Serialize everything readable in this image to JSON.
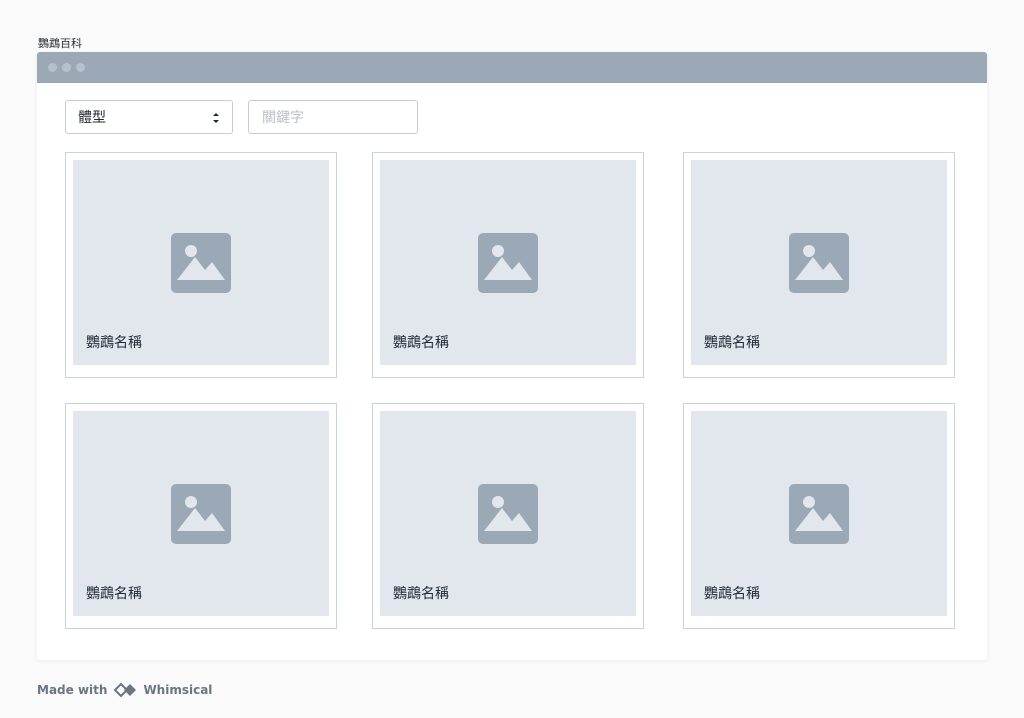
{
  "page_label": "鸚鵡百科",
  "filter": {
    "select_value": "體型",
    "keyword_placeholder": "關鍵字"
  },
  "cards": [
    {
      "label": "鸚鵡名稱",
      "image_icon": "image-placeholder-icon"
    },
    {
      "label": "鸚鵡名稱",
      "image_icon": "image-placeholder-icon"
    },
    {
      "label": "鸚鵡名稱",
      "image_icon": "image-placeholder-icon"
    },
    {
      "label": "鸚鵡名稱",
      "image_icon": "image-placeholder-icon"
    },
    {
      "label": "鸚鵡名稱",
      "image_icon": "image-placeholder-icon"
    },
    {
      "label": "鸚鵡名稱",
      "image_icon": "image-placeholder-icon"
    }
  ],
  "footer": {
    "made_with": "Made with",
    "brand": "Whimsical",
    "logo_icon": "whimsical-logo-icon"
  },
  "colors": {
    "titlebar": "#9ba9b6",
    "card_fill": "#e2e6ed",
    "icon": "#9ba9b6",
    "border": "#c9d1d9"
  }
}
